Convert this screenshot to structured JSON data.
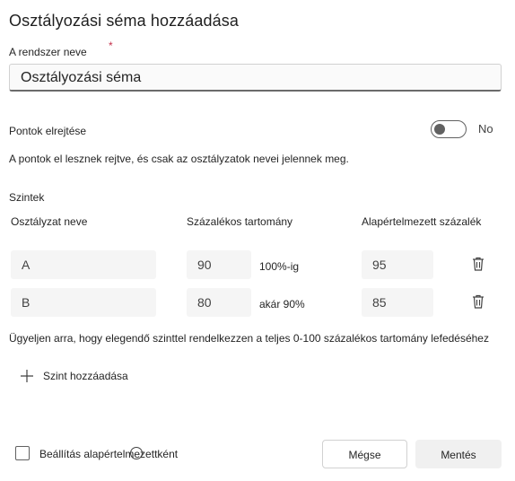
{
  "dialog": {
    "title": "Osztályozási séma hozzáadása",
    "name_label": "A rendszer neve",
    "required_mark": "*",
    "name_value": "Osztályozási séma"
  },
  "hide_points": {
    "label": "Pontok elrejtése",
    "state_text": "No",
    "enabled": false,
    "description": "A pontok el lesznek rejtve, és csak az osztályzatok nevei jelennek meg."
  },
  "levels": {
    "section_label": "Szintek",
    "columns": {
      "grade_name": "Osztályzat neve",
      "percent_range": "Százalékos tartomány",
      "default_percent": "Alapértelmezett százalék"
    },
    "rows": [
      {
        "name": "A",
        "range_value": "90",
        "range_text": "100%-ig",
        "default": "95"
      },
      {
        "name": "B",
        "range_value": "80",
        "range_text": "akár 90%",
        "default": "85"
      }
    ],
    "warning": "Ügyeljen arra, hogy elegendő szinttel rendelkezzen a teljes 0-100 százalékos tartomány lefedéséhez",
    "add_level_label": "Szint hozzáadása"
  },
  "footer": {
    "default_checkbox_label": "Beállítás alapértelmezettként",
    "default_checked": false,
    "cancel_label": "Mégse",
    "save_label": "Mentés"
  },
  "colors": {
    "required": "#c4314b",
    "input_bg": "#f5f5f5",
    "save_bg": "#f0f0f0"
  }
}
